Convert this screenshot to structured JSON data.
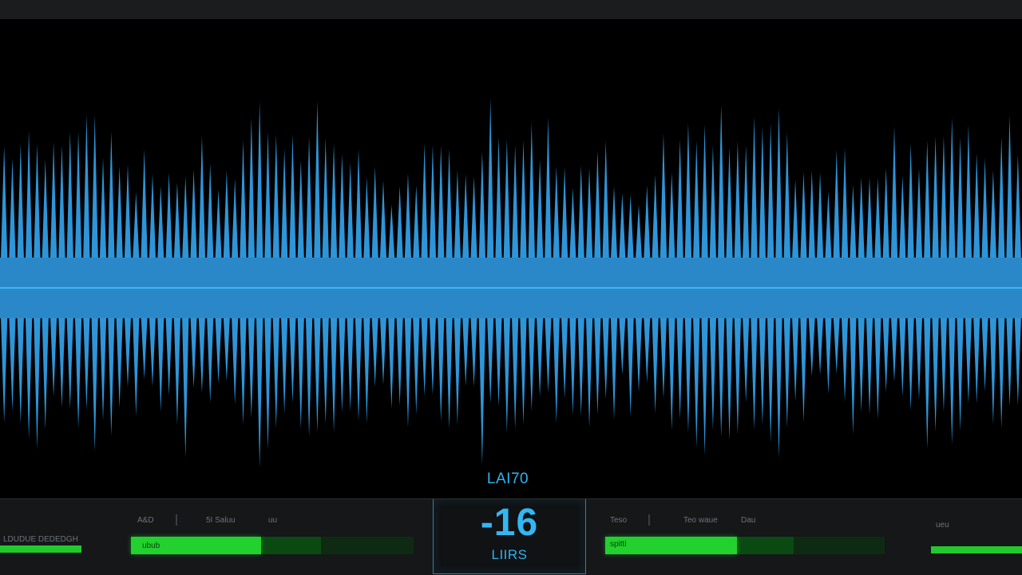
{
  "window": {
    "title": ""
  },
  "waveform": {
    "color": "#2e95d8",
    "center_band_color": "#2a88c8",
    "center_line_color": "#3fb6f2",
    "bar_count": 124
  },
  "meter": {
    "title": "LAI70",
    "value": "-16",
    "unit": "LIIRS",
    "accent": "#33b7f2"
  },
  "left_meter": {
    "caption": "LDUDUE DEDEDGH",
    "level": 1.0,
    "color": "#21c92c"
  },
  "channel_a": {
    "labels": [
      "A&D",
      "I",
      "5I  Saluu",
      "uu"
    ],
    "fill_label": "ubub",
    "level": 0.46,
    "color": "#22d12e"
  },
  "channel_b": {
    "labels": [
      "Teso",
      "I",
      "Teo waue",
      "Dau"
    ],
    "fill_label": "spitti",
    "level": 0.47,
    "color": "#22d12e"
  },
  "right_meter": {
    "caption": "ueu",
    "level": 1.0,
    "color": "#21c92c"
  }
}
